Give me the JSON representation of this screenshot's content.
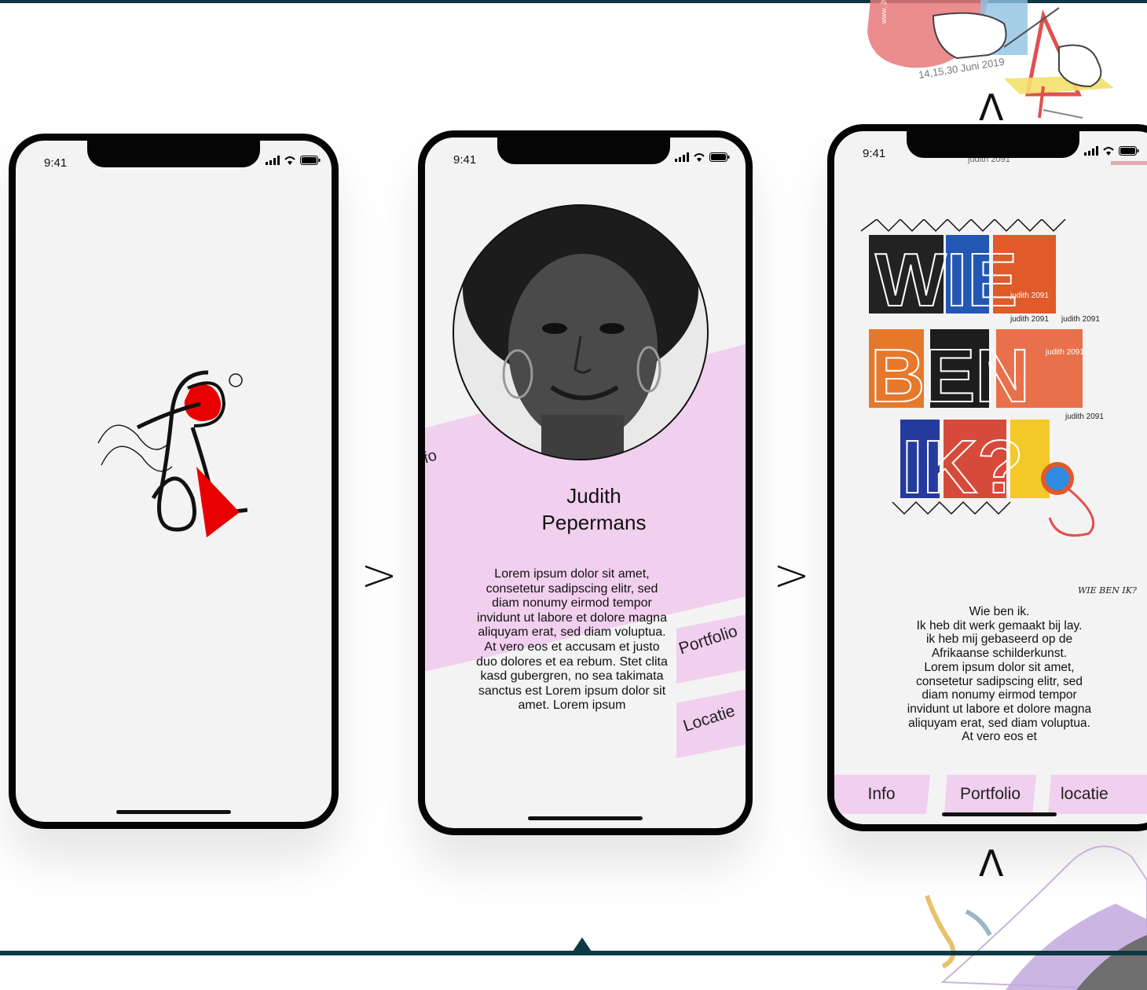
{
  "status_bar": {
    "time": "9:41"
  },
  "navigation": {
    "next_arrow": ">",
    "up_arrow": "Λ"
  },
  "screen1": {},
  "screen2": {
    "tab_info": "Info",
    "name_line1": "Judith",
    "name_line2": "Pepermans",
    "body": "Lorem ipsum dolor sit amet, consetetur sadipscing elitr, sed diam nonumy eirmod tempor invidunt ut labore et dolore magna aliquyam erat, sed diam voluptua. At vero eos et accusam et justo duo dolores et ea rebum. Stet clita kasd gubergren, no sea takimata sanctus est Lorem ipsum dolor sit amet. Lorem ipsum",
    "tab_portfolio": "Portfolio",
    "tab_locatie": "Locatie"
  },
  "screen3": {
    "art_title_lines": [
      "WIE",
      "BEN",
      "IK?"
    ],
    "art_signatures": [
      "judith 2091",
      "judith 2091",
      "judith 2091",
      "judith 2091",
      "judith 2091"
    ],
    "art_caption": "WIE BEN IK?",
    "cut_off_top_text": "judith 2091",
    "text_lines": [
      "Wie ben ik.",
      "Ik heb dit werk gemaakt bij lay.",
      "ik heb mij gebaseerd op de",
      "Afrikaanse schilderkunst.",
      "Lorem ipsum dolor sit amet,",
      "consetetur sadipscing elitr, sed",
      "diam nonumy eirmod tempor",
      "invidunt ut labore et dolore magna",
      "aliquyam erat, sed diam voluptua.",
      "At vero eos et"
    ],
    "nav": [
      "Info",
      "Portfolio",
      "locatie"
    ]
  },
  "poster": {
    "date_text": "14,15,30 Juni 2019",
    "side_text": "www. 2019 be"
  },
  "colors": {
    "accent_pink": "#f1cfee",
    "dark_bar": "#0e3944",
    "logo_red": "#e80000"
  }
}
